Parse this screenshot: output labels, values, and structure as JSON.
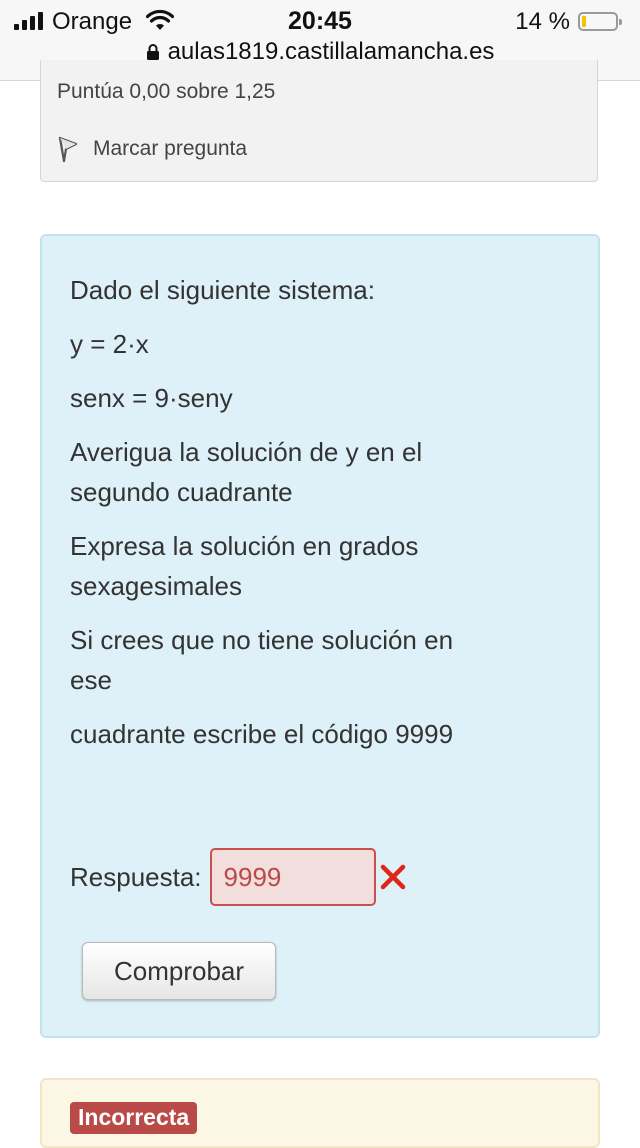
{
  "status_bar": {
    "carrier": "Orange",
    "time": "20:45",
    "battery_percent": "14 %",
    "battery_level": 0.14,
    "signal_bars": 4
  },
  "browser": {
    "url": "aulas1819.castillalamancha.es"
  },
  "previous_question": {
    "grade": "Puntúa 0,00 sobre 1,25",
    "flag_label": "Marcar pregunta"
  },
  "question": {
    "lines": [
      "Dado el siguiente sistema:",
      "y = 2·x",
      "senx = 9·seny",
      "Averigua la solución de y en el segundo cuadrante",
      "Expresa la solución en grados sexagesimales",
      "Si crees que no tiene solución en ese",
      "cuadrante escribe el código 9999"
    ],
    "answer_label": "Respuesta:",
    "answer_value": "9999",
    "check_button": "Comprobar"
  },
  "feedback": {
    "status": "Incorrecta"
  },
  "colors": {
    "question_bg": "#def0f8",
    "incorrect": "#b94a48",
    "feedback_bg": "#fdf7e6"
  }
}
